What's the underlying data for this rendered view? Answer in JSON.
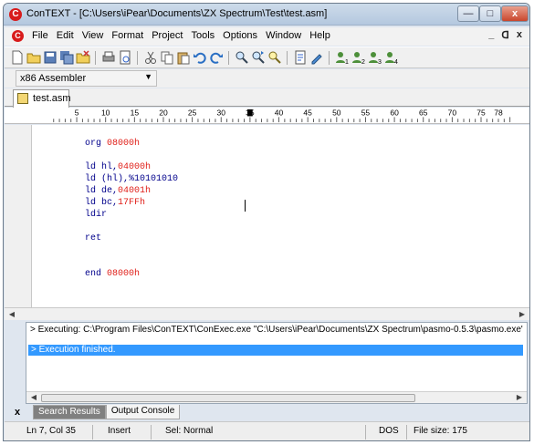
{
  "window": {
    "title": "ConTEXT - [C:\\Users\\iPear\\Documents\\ZX Spectrum\\Test\\test.asm]",
    "app_icon_letter": "C",
    "min_glyph": "—",
    "max_glyph": "□",
    "close_glyph": "x"
  },
  "menu": {
    "items": [
      "File",
      "Edit",
      "View",
      "Format",
      "Project",
      "Tools",
      "Options",
      "Window",
      "Help"
    ],
    "mdi_min": "_",
    "mdi_restore": "ᗡ",
    "mdi_close": "x"
  },
  "highlighter": {
    "selected": "x86 Assembler"
  },
  "file_tab": {
    "label": "test.asm"
  },
  "ruler": {
    "labels": [
      "5",
      "10",
      "15",
      "20",
      "25",
      "30",
      "35",
      "40",
      "45",
      "50",
      "55",
      "60",
      "65",
      "70",
      "75",
      "78"
    ]
  },
  "editor": {
    "lines": [
      [
        {
          "t": "org ",
          "c": "kw"
        },
        {
          "t": "08000h",
          "c": "num"
        }
      ],
      [],
      [
        {
          "t": "ld hl,",
          "c": "kw"
        },
        {
          "t": "04000h",
          "c": "num"
        }
      ],
      [
        {
          "t": "ld (hl),%10101010",
          "c": "kw"
        }
      ],
      [
        {
          "t": "ld de,",
          "c": "kw"
        },
        {
          "t": "04001h",
          "c": "num"
        }
      ],
      [
        {
          "t": "ld bc,",
          "c": "kw"
        },
        {
          "t": "17FFh",
          "c": "num"
        }
      ],
      [
        {
          "t": "ldir",
          "c": "kw"
        }
      ],
      [],
      [
        {
          "t": "ret",
          "c": "kw"
        }
      ],
      [],
      [],
      [
        {
          "t": "end ",
          "c": "kw"
        },
        {
          "t": "08000h",
          "c": "num"
        }
      ]
    ]
  },
  "output": {
    "executing": "> Executing: C:\\Program Files\\ConTEXT\\ConExec.exe \"C:\\Users\\iPear\\Documents\\ZX Spectrum\\pasmo-0.5.3\\pasmo.exe\" --tapbas C:\\",
    "finished": "> Execution finished.",
    "close_glyph": "x"
  },
  "bottom_tabs": {
    "search": "Search Results",
    "console": "Output Console"
  },
  "status": {
    "position": "Ln 7, Col 35",
    "mode": "Insert",
    "selection": "Sel: Normal",
    "format": "DOS",
    "file_size": "File size: 175"
  },
  "colors": {
    "keyword": "#00008b",
    "number": "#e0201a",
    "selection": "#3399ff"
  }
}
